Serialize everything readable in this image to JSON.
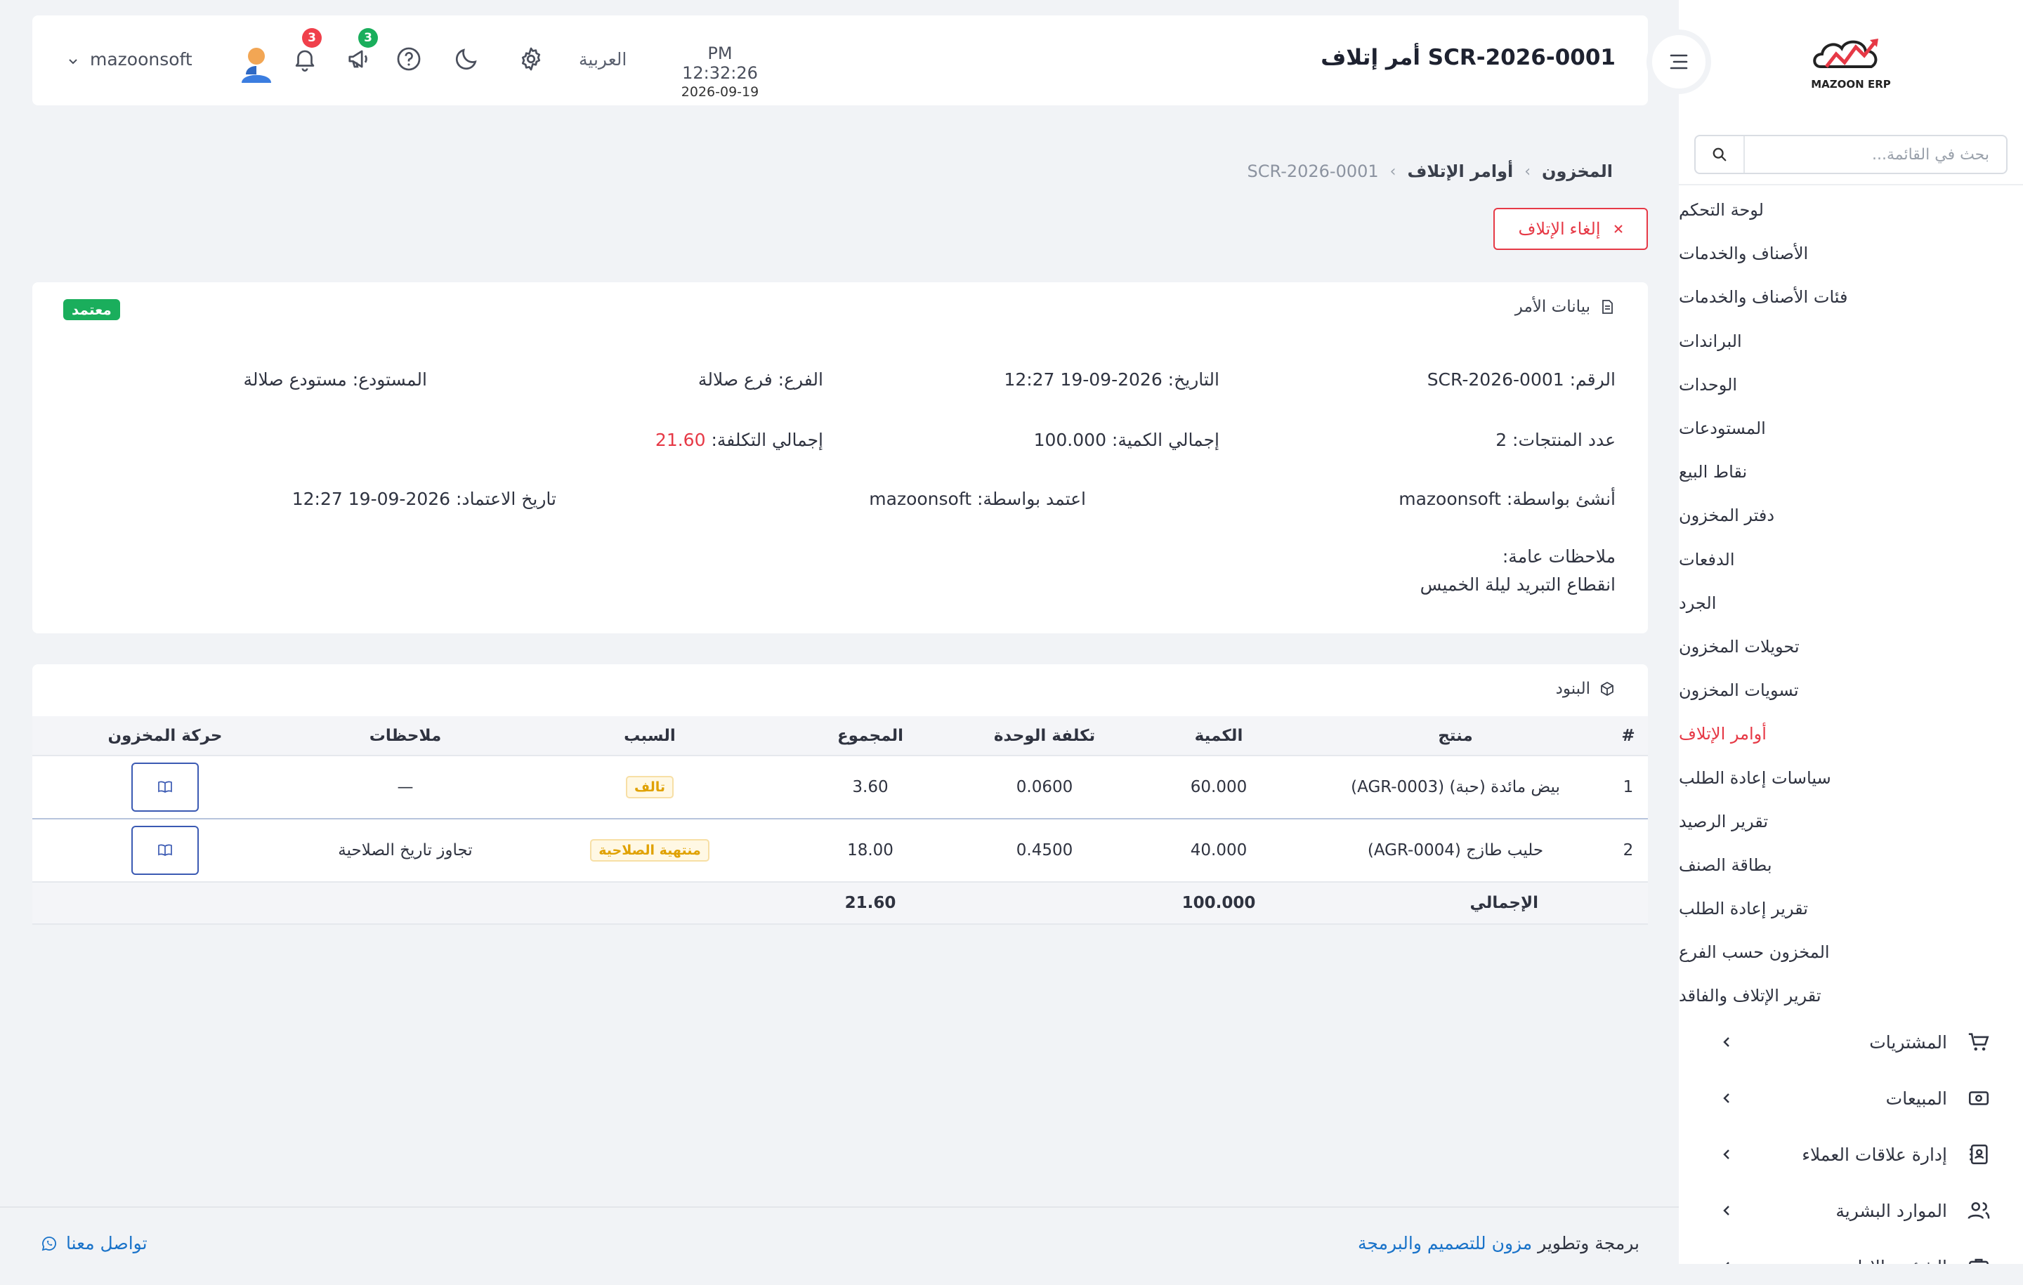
{
  "sidebar": {
    "logo_text": "MAZOON ERP",
    "search_placeholder": "بحث في القائمة...",
    "submenu": [
      {
        "label": "لوحة التحكم"
      },
      {
        "label": "الأصناف والخدمات"
      },
      {
        "label": "فئات الأصناف والخدمات"
      },
      {
        "label": "البراندات"
      },
      {
        "label": "الوحدات"
      },
      {
        "label": "المستودعات"
      },
      {
        "label": "نقاط البيع"
      },
      {
        "label": "دفتر المخزون"
      },
      {
        "label": "الدفعات"
      },
      {
        "label": "الجرد"
      },
      {
        "label": "تحويلات المخزون"
      },
      {
        "label": "تسويات المخزون"
      },
      {
        "label": "أوامر الإتلاف"
      },
      {
        "label": "سياسات إعادة الطلب"
      },
      {
        "label": "تقرير الرصيد"
      },
      {
        "label": "بطاقة الصنف"
      },
      {
        "label": "تقرير إعادة الطلب"
      },
      {
        "label": "المخزون حسب الفرع"
      },
      {
        "label": "تقرير الإتلاف والفاقد"
      }
    ],
    "active_item": "أوامر الإتلاف",
    "mainmenu": [
      {
        "label": "المشتريات",
        "icon": "cart-icon"
      },
      {
        "label": "المبيعات",
        "icon": "cash-register-icon"
      },
      {
        "label": "إدارة علاقات العملاء",
        "icon": "contacts-book-icon"
      },
      {
        "label": "الموارد البشرية",
        "icon": "users-icon"
      },
      {
        "label": "الشؤون الإدارية",
        "icon": "briefcase-icon"
      }
    ]
  },
  "header": {
    "title": "أمر إتلاف SCR-2026-0001",
    "time": "PM 12:32:26",
    "date": "2026-09-19",
    "language": "العربية",
    "announcements_count": "3",
    "notifications_count": "3",
    "username": "mazoonsoft"
  },
  "breadcrumb": {
    "level1": "المخزون",
    "level2": "أوامر الإتلاف",
    "level3": "SCR-2026-0001",
    "separator": "‹"
  },
  "actions": {
    "cancel_label": "إلغاء الإتلاف"
  },
  "order": {
    "section_title": "بيانات الأمر",
    "status": "معتمد",
    "number": "الرقم: SCR-2026-0001",
    "date": "التاريخ: 2026-09-19 12:27",
    "branch": "الفرع: فرع صلالة",
    "warehouse": "المستودع: مستودع صلالة",
    "products_count": "عدد المنتجات: 2",
    "total_qty": "إجمالي الكمية: 100.000",
    "total_cost_label": "إجمالي التكلفة:",
    "total_cost_value": "21.60",
    "created_by": "أنشئ بواسطة: mazoonsoft",
    "approved_by": "اعتمد بواسطة: mazoonsoft",
    "approved_at": "تاريخ الاعتماد: 2026-09-19 12:27",
    "notes_label": "ملاحظات عامة:",
    "notes_value": "انقطاع التبريد ليلة الخميس"
  },
  "items": {
    "section_title": "البنود",
    "columns": [
      "#",
      "منتج",
      "الكمية",
      "تكلفة الوحدة",
      "المجموع",
      "السبب",
      "ملاحظات",
      "حركة المخزون"
    ],
    "rows": [
      {
        "n": "1",
        "product": "بيض مائدة (حبة) (AGR-0003)",
        "qty": "60.000",
        "unit_cost": "0.0600",
        "total": "3.60",
        "reason": "تالف",
        "notes": "—"
      },
      {
        "n": "2",
        "product": "حليب طازج (AGR-0004)",
        "qty": "40.000",
        "unit_cost": "0.4500",
        "total": "18.00",
        "reason": "منتهية الصلاحية",
        "notes": "تجاوز تاريخ الصلاحية"
      }
    ],
    "total_label": "الإجمالي",
    "total_qty": "100.000",
    "total_value": "21.60"
  },
  "footer": {
    "credit_prefix": "برمجة وتطوير",
    "credit_link": "مزون للتصميم والبرمجة",
    "contact": "تواصل معنا"
  },
  "colors": {
    "accent_red": "#e63946",
    "approved_green": "#1aae5c",
    "link_blue": "#1a73c9",
    "warning_amber": "#e0a100"
  }
}
